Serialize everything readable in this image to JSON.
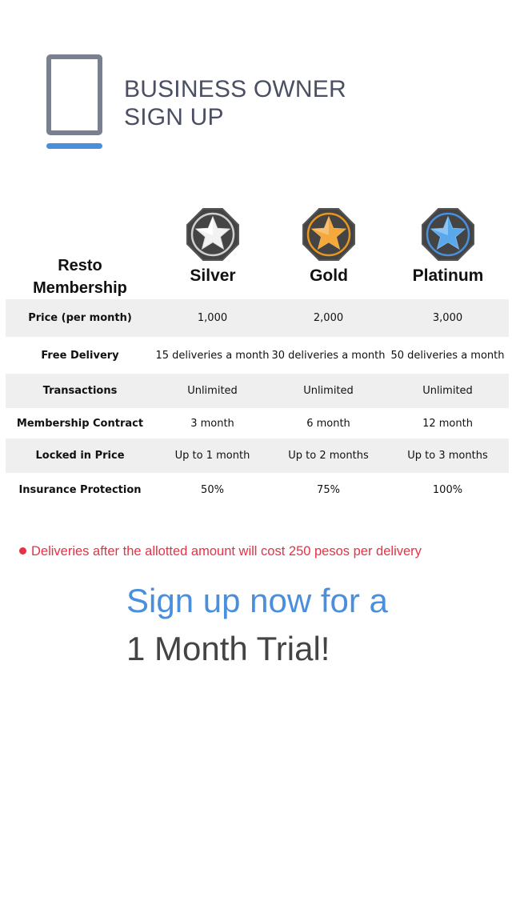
{
  "header": {
    "title_line1": "BUSINESS OWNER",
    "title_line2": "SIGN UP",
    "icon": "tablet-icon"
  },
  "membership": {
    "corner_label_line1": "Resto",
    "corner_label_line2": "Membership",
    "tiers": [
      {
        "name": "Silver",
        "icon": "silver-star-badge-icon",
        "accent": "#ffffff"
      },
      {
        "name": "Gold",
        "icon": "gold-star-badge-icon",
        "accent": "#f5a83b"
      },
      {
        "name": "Platinum",
        "icon": "platinum-star-badge-icon",
        "accent": "#5aa8ec"
      }
    ],
    "rows": [
      {
        "label": "Price (per month)",
        "values": [
          "1,000",
          "2,000",
          "3,000"
        ]
      },
      {
        "label": "Free Delivery",
        "values": [
          "15 deliveries a month",
          "30 deliveries a month",
          "50 deliveries a month"
        ]
      },
      {
        "label": "Transactions",
        "values": [
          "Unlimited",
          "Unlimited",
          "Unlimited"
        ]
      },
      {
        "label": "Membership Contract",
        "values": [
          "3 month",
          "6 month",
          "12 month"
        ]
      },
      {
        "label": "Locked in Price",
        "values": [
          "Up to 1 month",
          "Up to 2 months",
          "Up to 3 months"
        ]
      },
      {
        "label": "Insurance Protection",
        "values": [
          "50%",
          "75%",
          "100%"
        ]
      }
    ]
  },
  "note": {
    "text": "Deliveries after the allotted amount will cost 250 pesos per delivery",
    "color": "#e63244"
  },
  "cta": {
    "line1": "Sign up now for a",
    "line2": "1 Month Trial!",
    "accent": "#4a8fdc"
  }
}
